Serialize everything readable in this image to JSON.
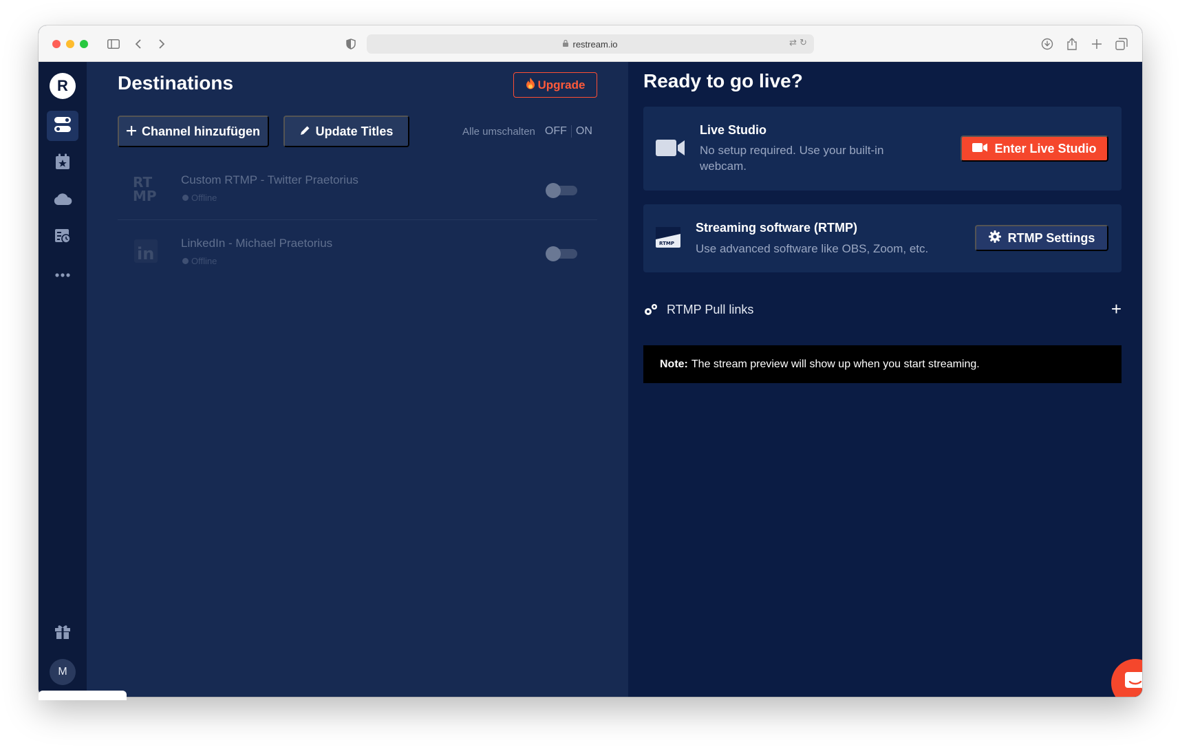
{
  "browser": {
    "url": "restream.io"
  },
  "sidebar": {
    "logo_letter": "R",
    "avatar_initial": "M"
  },
  "destinations": {
    "title": "Destinations",
    "upgrade_label": "Upgrade",
    "add_channel_label": "Channel hinzufügen",
    "update_titles_label": "Update Titles",
    "toggle_all_label": "Alle umschalten",
    "toggle_off_label": "OFF",
    "toggle_on_label": "ON",
    "channels": [
      {
        "name": "Custom RTMP - Twitter Praetorius",
        "status": "Offline",
        "icon": "rtmp-icon",
        "enabled": false
      },
      {
        "name": "LinkedIn - Michael Praetorius",
        "status": "Offline",
        "icon": "linkedin-icon",
        "enabled": false
      }
    ]
  },
  "live": {
    "title": "Ready to go live?",
    "studio": {
      "title": "Live Studio",
      "description": "No setup required. Use your built-in webcam.",
      "button_label": "Enter Live Studio"
    },
    "rtmp": {
      "title": "Streaming software (RTMP)",
      "description": "Use advanced software like OBS, Zoom, etc.",
      "button_label": "RTMP Settings",
      "icon_text": "RTMP"
    },
    "pull_links_label": "RTMP Pull links",
    "note_label": "Note:",
    "note_text": "The stream preview will show up when you start streaming."
  },
  "colors": {
    "accent": "#f5472c",
    "sidebar_bg": "#0c1a3b",
    "left_panel_bg": "#172a52",
    "right_panel_bg": "#0b1c44",
    "card_bg": "#142a55"
  }
}
